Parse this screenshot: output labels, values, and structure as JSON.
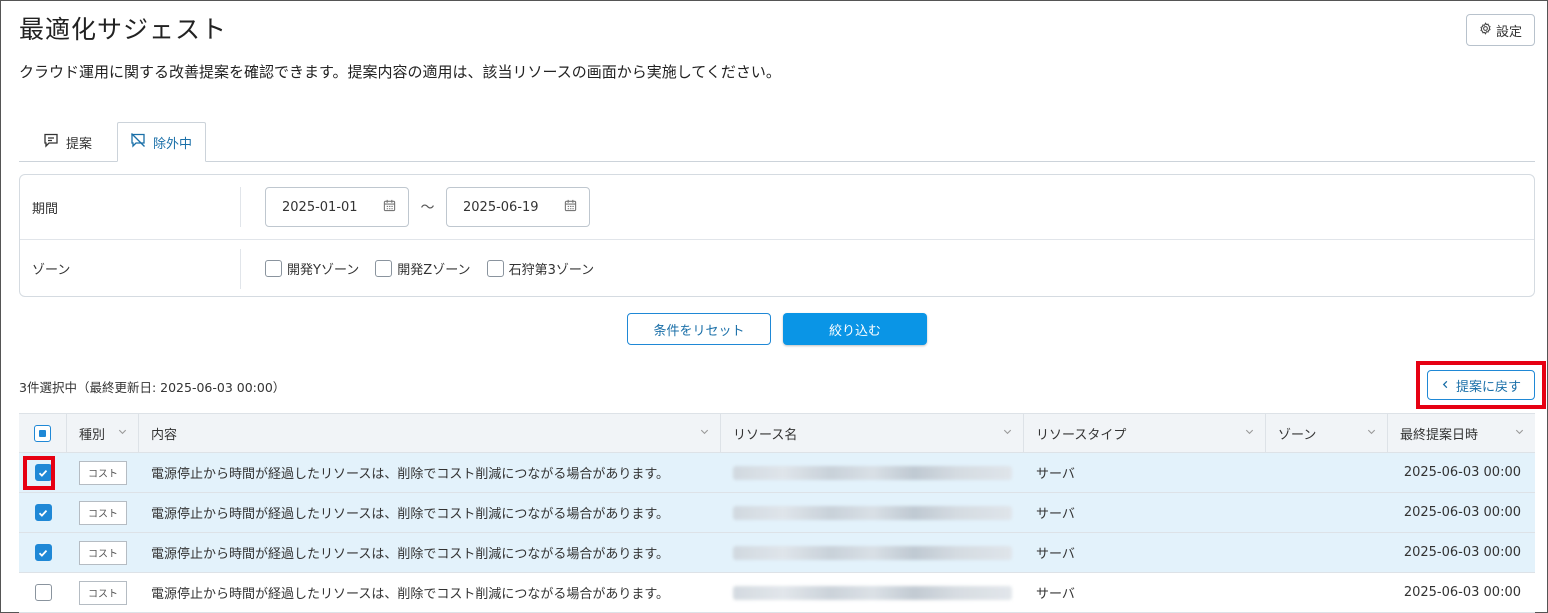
{
  "page": {
    "title": "最適化サジェスト",
    "description": "クラウド運用に関する改善提案を確認できます。提案内容の適用は、該当リソースの画面から実施してください。",
    "settings_label": "設定"
  },
  "tabs": [
    {
      "label": "提案",
      "icon": "comment-icon",
      "active": false
    },
    {
      "label": "除外中",
      "icon": "comment-off-icon",
      "active": true
    }
  ],
  "filter": {
    "period_label": "期間",
    "date_from": "2025-01-01",
    "date_separator": "～",
    "date_to": "2025-06-19",
    "zone_label": "ゾーン",
    "zones": [
      {
        "label": "開発Yゾーン",
        "checked": false
      },
      {
        "label": "開発Zゾーン",
        "checked": false
      },
      {
        "label": "石狩第3ゾーン",
        "checked": false
      }
    ],
    "reset_label": "条件をリセット",
    "apply_label": "絞り込む"
  },
  "selection_status": "3件選択中（最終更新日: 2025-06-03 00:00）",
  "back_button_label": "提案に戻す",
  "table": {
    "columns": [
      "種別",
      "内容",
      "リソース名",
      "リソースタイプ",
      "ゾーン",
      "最終提案日時"
    ],
    "rows": [
      {
        "checked": true,
        "type": "コスト",
        "content": "電源停止から時間が経過したリソースは、削除でコスト削減につながる場合があります。",
        "resource_type": "サーバ",
        "zone": "",
        "date": "2025-06-03 00:00"
      },
      {
        "checked": true,
        "type": "コスト",
        "content": "電源停止から時間が経過したリソースは、削除でコスト削減につながる場合があります。",
        "resource_type": "サーバ",
        "zone": "",
        "date": "2025-06-03 00:00"
      },
      {
        "checked": true,
        "type": "コスト",
        "content": "電源停止から時間が経過したリソースは、削除でコスト削減につながる場合があります。",
        "resource_type": "サーバ",
        "zone": "",
        "date": "2025-06-03 00:00"
      },
      {
        "checked": false,
        "type": "コスト",
        "content": "電源停止から時間が経過したリソースは、削除でコスト削減につながる場合があります。",
        "resource_type": "サーバ",
        "zone": "",
        "date": "2025-06-03 00:00"
      }
    ]
  },
  "colors": {
    "primary": "#0a95e6",
    "highlight": "#e60012",
    "selected_row": "#e3f2fb"
  }
}
